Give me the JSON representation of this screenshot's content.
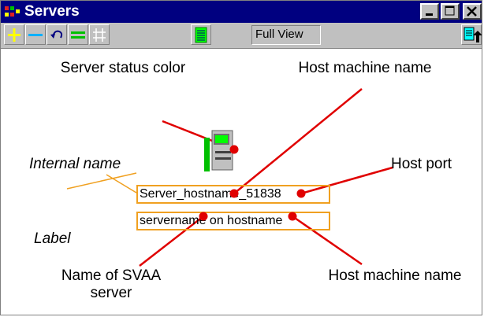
{
  "window": {
    "title": "Servers"
  },
  "toolbar": {
    "view_label": "Full View",
    "tools": [
      "add-icon",
      "remove-icon",
      "undo-icon",
      "equal-icon",
      "grid-icon",
      "list-icon",
      "export-icon"
    ]
  },
  "server_node": {
    "internal_name": "Server_hostname_51838",
    "label": "servername on hostname"
  },
  "callouts": {
    "server_status_color": "Server status color",
    "host_machine_name_top": "Host machine name",
    "internal_name": "Internal name",
    "host_port": "Host port",
    "label": "Label",
    "name_of_svaa_server": "Name of SVAA server",
    "host_machine_name_bottom": "Host machine name"
  },
  "colors": {
    "titlebar": "#000080",
    "callout_line": "#e00000",
    "box_border": "#f0a020",
    "status_green": "#00c000"
  }
}
